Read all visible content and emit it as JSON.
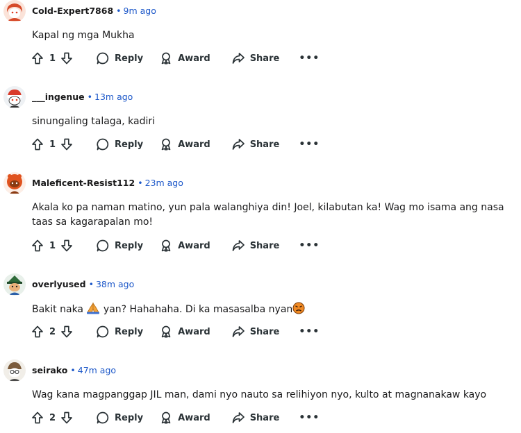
{
  "comments": [
    {
      "username": "Cold-Expert7868",
      "time": "9m ago",
      "text": "Kapal ng mga Mukha",
      "votes": "1",
      "avatar": "snoo-avatar-red-hair"
    },
    {
      "username": "___ingenue",
      "time": "13m ago",
      "text": "sinungaling talaga, kadiri",
      "votes": "1",
      "avatar": "snoo-avatar-red-beanie"
    },
    {
      "username": "Maleficent-Resist112",
      "time": "23m ago",
      "text": "Akala ko pa naman matino, yun pala walanghiya din! Joel, kilabutan ka! Wag mo isama ang nasa taas sa kagarapalan mo!",
      "votes": "1",
      "avatar": "snoo-avatar-brown"
    },
    {
      "username": "overlyused",
      "time": "38m ago",
      "text_before": "Bakit naka ",
      "text_mid": " yan? Hahahaha. Di ka masasalba nyan",
      "votes": "2",
      "avatar": "snoo-avatar-green-hat",
      "emojis": [
        "folded-hands-emoji",
        "angry-face-emoji"
      ]
    },
    {
      "username": "seirako",
      "time": "47m ago",
      "text": "Wag kana magpanggap JIL man, dami nyo nauto sa relihiyon nyo, kulto at magnanakaw kayo",
      "votes": "2",
      "avatar": "snoo-avatar-glasses"
    }
  ],
  "actions": {
    "reply": "Reply",
    "award": "Award",
    "share": "Share",
    "more": "•••"
  },
  "separator": "•",
  "colors": {
    "link_blue": "#1d58c9",
    "text": "#1a1a1b",
    "icon": "#2a3236"
  }
}
